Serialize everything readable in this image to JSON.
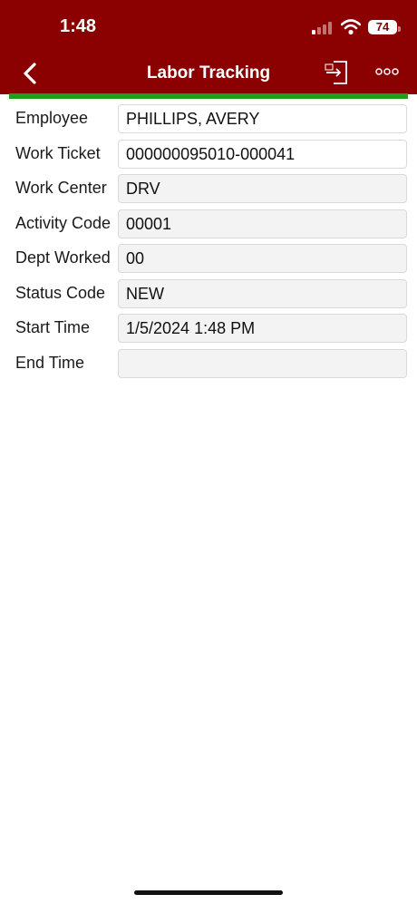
{
  "status_bar": {
    "time": "1:48",
    "battery": "74"
  },
  "header": {
    "title": "Labor Tracking"
  },
  "form": {
    "rows": [
      {
        "label": "Employee",
        "value": "PHILLIPS, AVERY"
      },
      {
        "label": "Work Ticket",
        "value": "000000095010-000041"
      },
      {
        "label": "Work Center",
        "value": "DRV"
      },
      {
        "label": "Activity Code",
        "value": "00001"
      },
      {
        "label": "Dept Worked",
        "value": "00"
      },
      {
        "label": "Status Code",
        "value": "NEW"
      },
      {
        "label": "Start Time",
        "value": "1/5/2024 1:48 PM"
      },
      {
        "label": "End Time",
        "value": ""
      }
    ]
  },
  "colors": {
    "header": "#8b0000",
    "accent_bar": "#1aa01a"
  }
}
